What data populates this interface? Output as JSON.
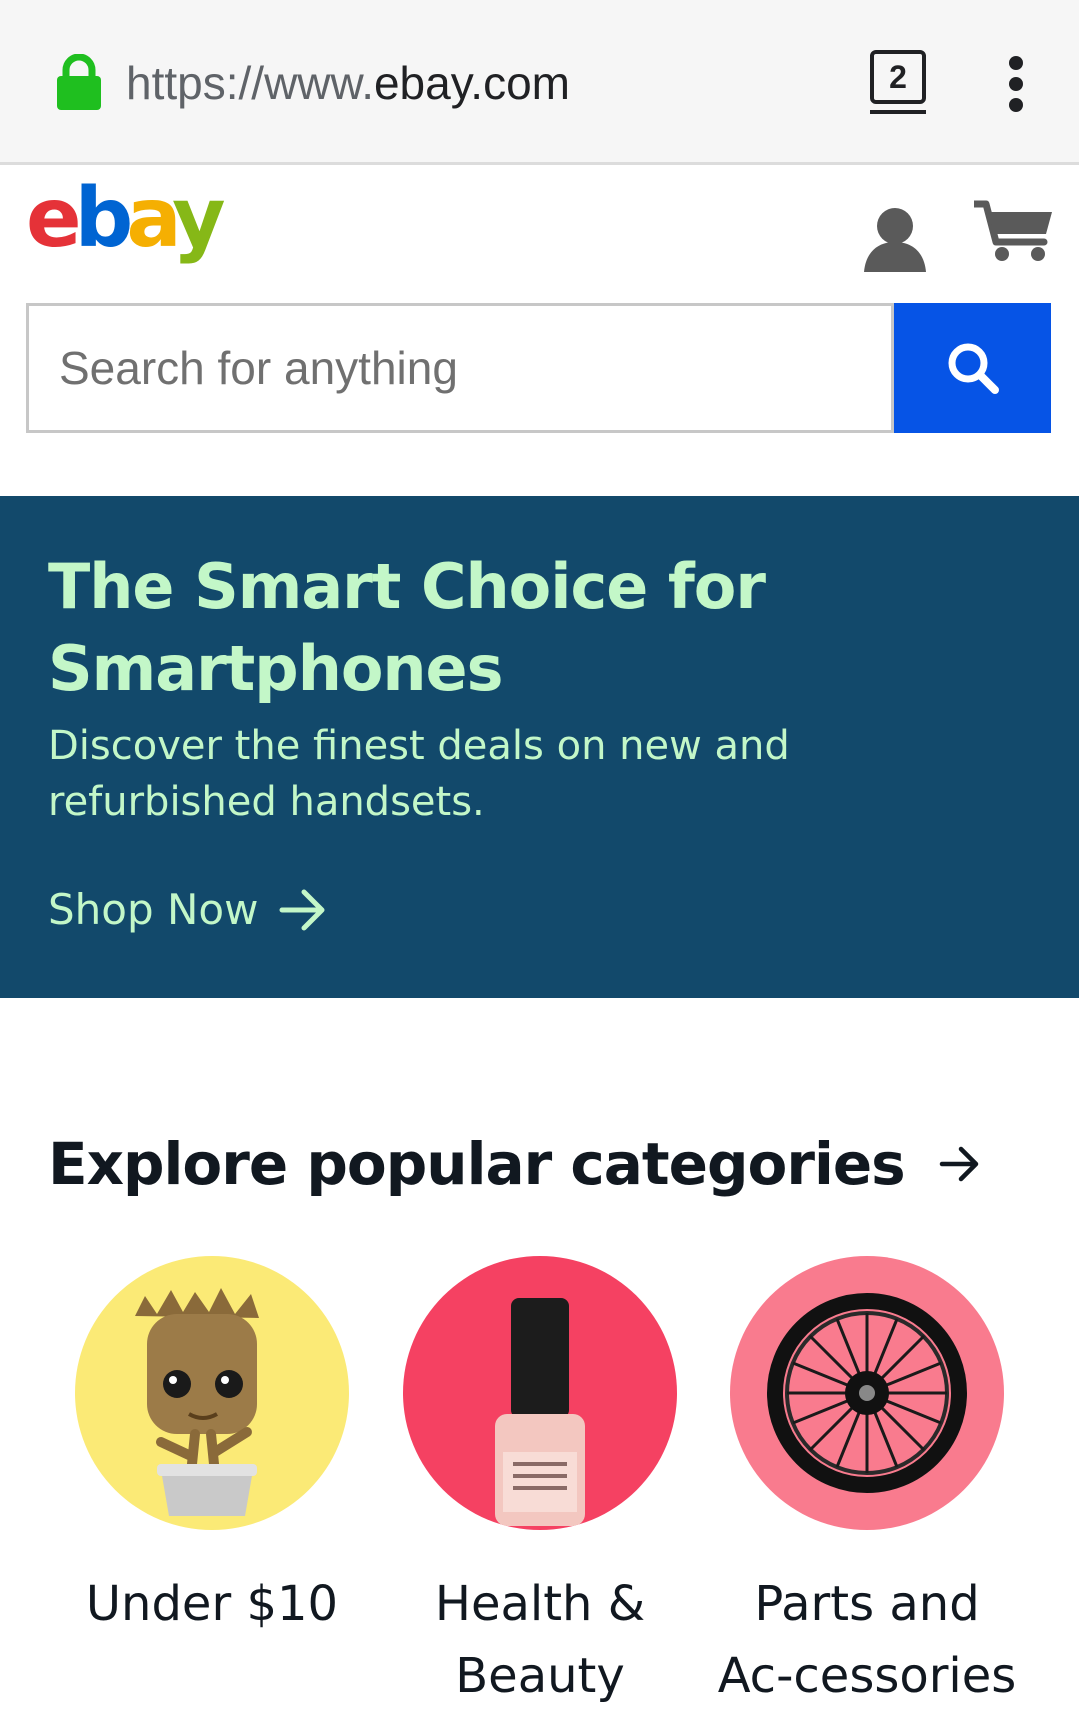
{
  "browser": {
    "url_scheme": "https://www.",
    "url_host": "ebay.com",
    "tab_count": "2"
  },
  "header": {
    "logo_text": "ebay",
    "search_placeholder": "Search for anything"
  },
  "banner": {
    "title": "The Smart Choice for Smartphones",
    "subtitle": "Discover the finest deals on new and refurbished handsets.",
    "cta": "Shop Now"
  },
  "categories": {
    "heading": "Explore popular categories",
    "items": [
      {
        "label": "Under $10",
        "color": "#fbea76"
      },
      {
        "label": "Health & Beauty",
        "color": "#f54162"
      },
      {
        "label": "Parts and Ac-cessories",
        "color": "#f97b8e"
      }
    ]
  },
  "colors": {
    "lock": "#1db954",
    "search_button": "#0654e6",
    "banner_bg": "#12496b",
    "banner_text": "#c3f7c8"
  }
}
